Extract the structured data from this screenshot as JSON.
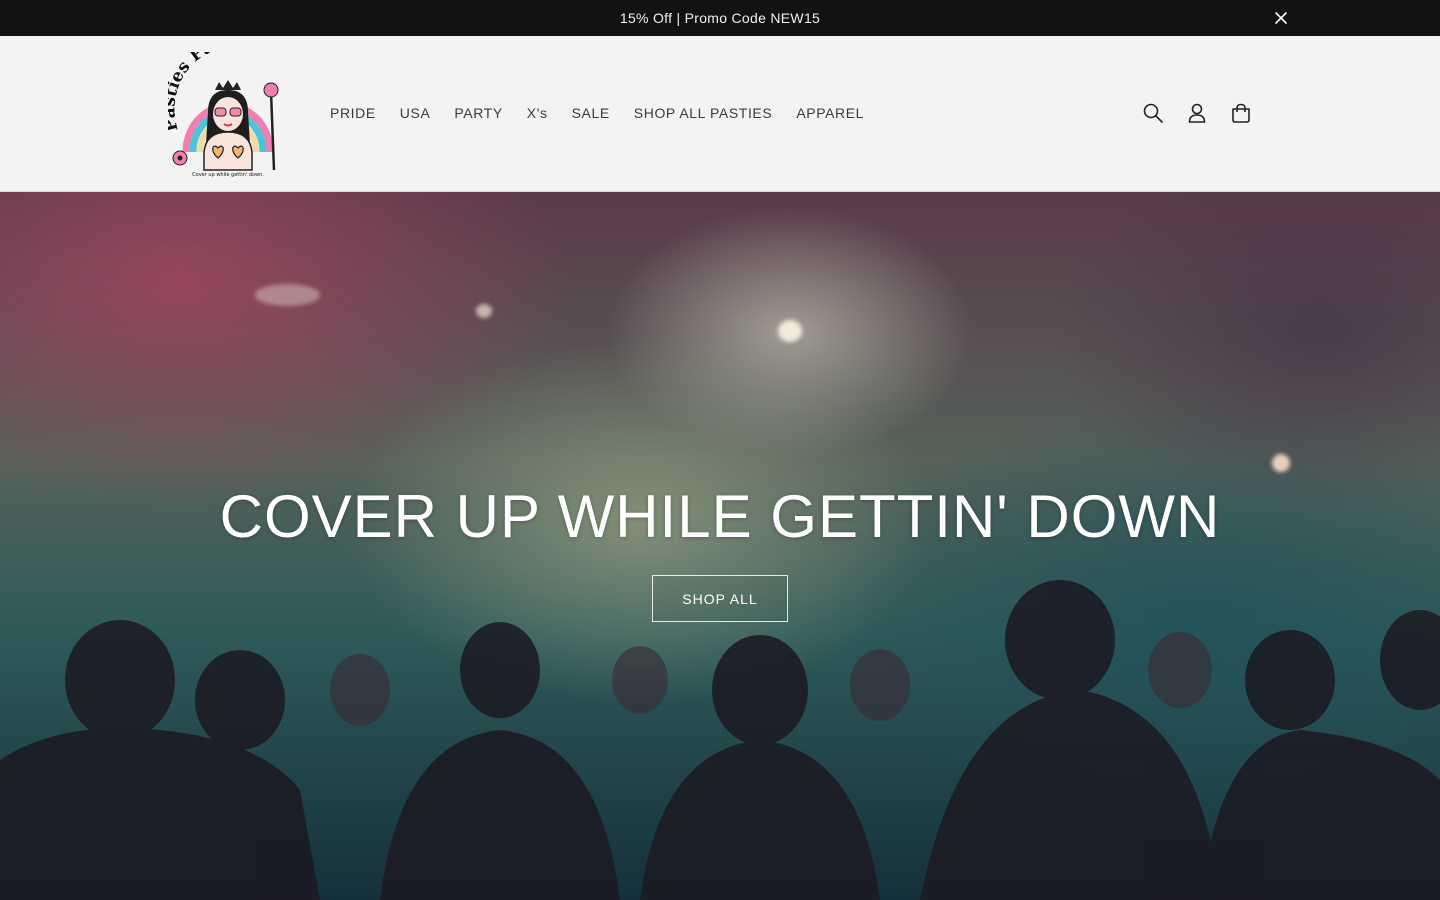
{
  "announcement": {
    "text": "15% Off | Promo Code NEW15",
    "close_icon": "close-icon"
  },
  "header": {
    "logo": {
      "alt": "Pasties Party",
      "wordmark": "Pasties Party",
      "tagline": "Cover up while gettin' down."
    },
    "nav": [
      {
        "label": "PRIDE"
      },
      {
        "label": "USA"
      },
      {
        "label": "PARTY"
      },
      {
        "label": "X's"
      },
      {
        "label": "SALE"
      },
      {
        "label": "SHOP ALL PASTIES"
      },
      {
        "label": "APPAREL"
      }
    ],
    "icons": [
      "search-icon",
      "account-icon",
      "cart-icon"
    ]
  },
  "hero": {
    "title": "COVER UP WHILE GETTIN' DOWN",
    "button_label": "SHOP ALL"
  },
  "colors": {
    "announcement_bg": "#121212",
    "header_bg": "#f3f3f3",
    "nav_text": "#3a3a3a",
    "hero_text": "#ffffff"
  }
}
